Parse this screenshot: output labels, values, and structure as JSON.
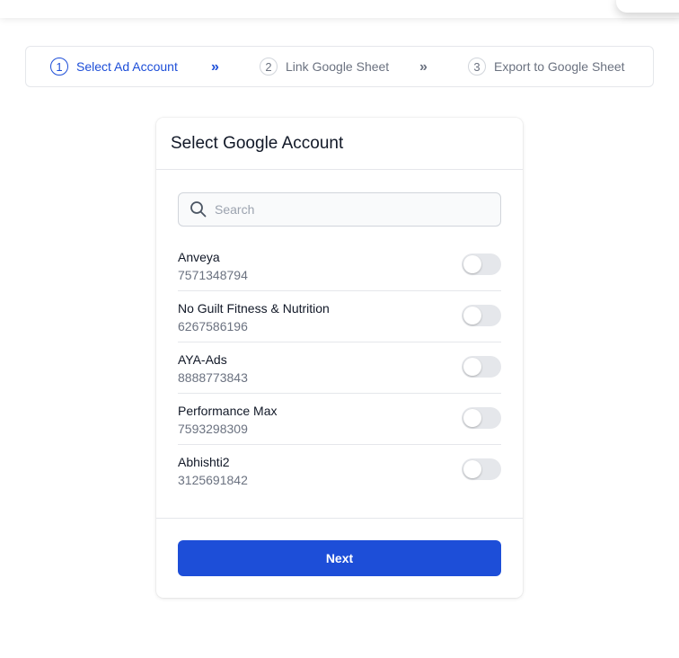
{
  "stepper": {
    "steps": [
      {
        "number": "1",
        "label": "Select Ad Account",
        "active": true
      },
      {
        "number": "2",
        "label": "Link Google Sheet",
        "active": false
      },
      {
        "number": "3",
        "label": "Export to Google Sheet",
        "active": false
      }
    ],
    "separator": "»"
  },
  "card": {
    "title": "Select Google Account",
    "search": {
      "placeholder": "Search",
      "value": ""
    },
    "accounts": [
      {
        "name": "Anveya",
        "id": "7571348794",
        "enabled": false
      },
      {
        "name": "No Guilt Fitness & Nutrition",
        "id": "6267586196",
        "enabled": false
      },
      {
        "name": "AYA-Ads",
        "id": "8888773843",
        "enabled": false
      },
      {
        "name": "Performance Max",
        "id": "7593298309",
        "enabled": false
      },
      {
        "name": "Abhishti2",
        "id": "3125691842",
        "enabled": false
      }
    ],
    "next_label": "Next"
  },
  "colors": {
    "accent": "#1d4ed8",
    "muted": "#6b7280",
    "toggle_off": "#e5e7eb"
  },
  "icons": {
    "search": "search-icon",
    "separator": "double-chevron-right-icon"
  }
}
